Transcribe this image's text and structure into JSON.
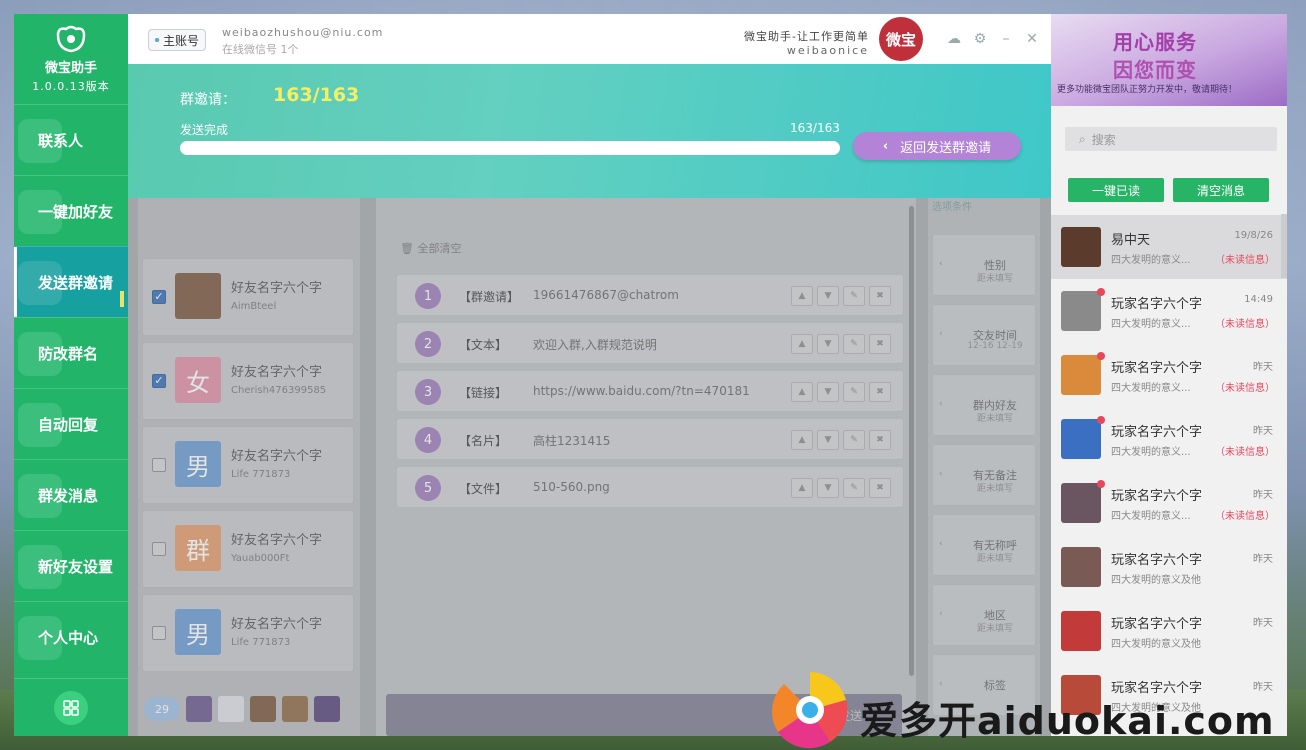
{
  "app": {
    "name": "微宝助手",
    "version": "1.0.0.13版本"
  },
  "sidebar": {
    "items": [
      {
        "label": "联系人"
      },
      {
        "label": "一键加好友"
      },
      {
        "label": "发送群邀请"
      },
      {
        "label": "防改群名"
      },
      {
        "label": "自动回复"
      },
      {
        "label": "群发消息"
      },
      {
        "label": "新好友设置"
      },
      {
        "label": "个人中心"
      }
    ],
    "active": "发送群邀请"
  },
  "header": {
    "account_tag": "主账号",
    "email": "weibaozhushou@niu.com",
    "online": "在线微信号 1个",
    "slogan": "微宝助手-让工作更简单",
    "slogan_sub": "weibaonice",
    "brand_badge": "微宝"
  },
  "invite": {
    "label": "群邀请：",
    "count": "163/163",
    "status": "发送完成",
    "ratio": "163/163",
    "progress_percent": 100,
    "back_button": "返回发送群邀请"
  },
  "friends": [
    {
      "name": "好友名字六个字",
      "id": "AimBteel",
      "checked": true,
      "avatar": "photo",
      "color": "#8a6a52"
    },
    {
      "name": "好友名字六个字",
      "id": "Cherish476399585",
      "checked": true,
      "avatar": "女",
      "color": "#e59bb0"
    },
    {
      "name": "好友名字六个字",
      "id": "Life 771873",
      "checked": false,
      "avatar": "男",
      "color": "#7aa6d8"
    },
    {
      "name": "好友名字六个字",
      "id": "Yauab000Ft",
      "checked": false,
      "avatar": "群",
      "color": "#e8a77a"
    },
    {
      "name": "好友名字六个字",
      "id": "Life 771873",
      "checked": false,
      "avatar": "男",
      "color": "#7aa6d8"
    }
  ],
  "selected_count": "29",
  "steps_header": "全部清空",
  "steps": [
    {
      "num": "1",
      "tag": "【群邀请】",
      "text": "19661476867@chatrom"
    },
    {
      "num": "2",
      "tag": "【文本】",
      "text": "欢迎入群,入群规范说明"
    },
    {
      "num": "3",
      "tag": "【链接】",
      "text": "https://www.baidu.com/?tn=470181"
    },
    {
      "num": "4",
      "tag": "【名片】",
      "text": "高柱1231415"
    },
    {
      "num": "5",
      "tag": "【文件】",
      "text": "510-560.png"
    }
  ],
  "send_button": "发送",
  "filters_header": "选项条件",
  "filters": [
    {
      "title": "性别",
      "sub": "距未填写"
    },
    {
      "title": "交友时间",
      "sub": "12-16   12-19"
    },
    {
      "title": "群内好友",
      "sub": "距未填写"
    },
    {
      "title": "有无备注",
      "sub": "距未填写"
    },
    {
      "title": "有无称呼",
      "sub": "距未填写"
    },
    {
      "title": "地区",
      "sub": "距未填写"
    },
    {
      "title": "标签",
      "sub": ""
    }
  ],
  "right_panel": {
    "ad_line1": "用心服务",
    "ad_line2": "因您而变",
    "ad_line3": "更多功能微宝团队正努力开发中，敬请期待！",
    "search_placeholder": "搜索",
    "read_all": "一键已读",
    "clear_msgs": "清空消息",
    "chats": [
      {
        "name": "易中天",
        "time": "19/8/26",
        "preview": "四大发明的意义...",
        "unread": "（未读信息）",
        "avatar_color": "#5b3c2c",
        "red": false
      },
      {
        "name": "玩家名字六个字",
        "time": "14:49",
        "preview": "四大发明的意义...",
        "unread": "（未读信息）",
        "avatar_color": "#8a8a8a",
        "red": true
      },
      {
        "name": "玩家名字六个字",
        "time": "昨天",
        "preview": "四大发明的意义...",
        "unread": "（未读信息）",
        "avatar_color": "#d98a3a",
        "red": true
      },
      {
        "name": "玩家名字六个字",
        "time": "昨天",
        "preview": "四大发明的意义...",
        "unread": "（未读信息）",
        "avatar_color": "#3a6fc2",
        "red": true
      },
      {
        "name": "玩家名字六个字",
        "time": "昨天",
        "preview": "四大发明的意义...",
        "unread": "（未读信息）",
        "avatar_color": "#6a5660",
        "red": true
      },
      {
        "name": "玩家名字六个字",
        "time": "昨天",
        "preview": "四大发明的意义及他",
        "unread": "",
        "avatar_color": "#7a5a54",
        "red": false
      },
      {
        "name": "玩家名字六个字",
        "time": "昨天",
        "preview": "四大发明的意义及他",
        "unread": "",
        "avatar_color": "#c23a3a",
        "red": false
      },
      {
        "name": "玩家名字六个字",
        "time": "昨天",
        "preview": "四大发明的意义及他",
        "unread": "",
        "avatar_color": "#b84a3a",
        "red": false
      }
    ]
  },
  "watermark": "爱多开aiduokai.com"
}
